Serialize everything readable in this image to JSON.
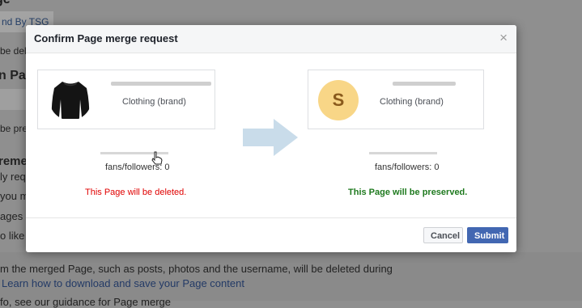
{
  "background": {
    "heading_fragment": "ge",
    "pill_fragment": "nd By TSG",
    "line_1": "be dele",
    "heading_2": "n Pa",
    "line_2": "be pres",
    "heading_3": "reme",
    "line_3": "ly requ",
    "line_4": "you m",
    "line_5": "ages c",
    "line_6": "o like t",
    "line_7": "m the merged Page, such as posts, photos and the username, will be deleted during",
    "link": "Learn how to download and save your Page content",
    "line_8": "fo, see our guidance for Page merge"
  },
  "modal": {
    "title": "Confirm Page merge request",
    "close_glyph": "×",
    "left_page": {
      "category": "Clothing (brand)",
      "fans": "fans/followers: 0",
      "status": "This Page will be deleted."
    },
    "right_page": {
      "avatar_letter": "S",
      "category": "Clothing (brand)",
      "fans": "fans/followers: 0",
      "status": "This Page will be preserved."
    },
    "buttons": {
      "cancel": "Cancel",
      "submit": "Submit"
    }
  },
  "colors": {
    "delete_status": "#e00000",
    "preserve_status": "#1f7a1f",
    "submit_button": "#4267b2",
    "arrow": "#c9dcea",
    "avatar_bg": "#f8d687"
  },
  "icons": {
    "close": "close-icon",
    "arrow": "arrow-right-icon",
    "cursor": "hand-cursor-icon"
  }
}
